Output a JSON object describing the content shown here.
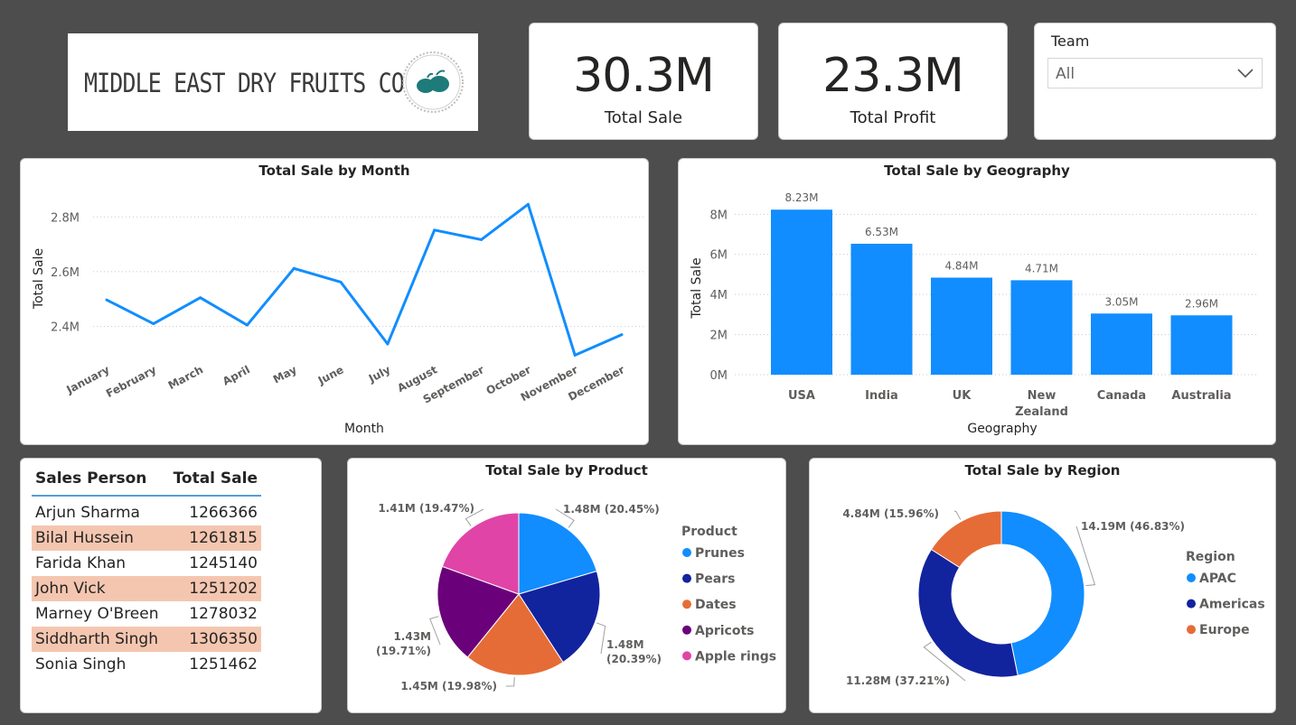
{
  "logo": {
    "text": "MIDDLE EAST DRY FRUITS CO."
  },
  "kpis": [
    {
      "value": "30.3M",
      "label": "Total Sale"
    },
    {
      "value": "23.3M",
      "label": "Total Profit"
    }
  ],
  "slicer": {
    "title": "Team",
    "value": "All"
  },
  "colors": {
    "line": "#118dff",
    "bar": "#118dff",
    "highlight_row": "#f4c6b0",
    "table_rule": "#5b9bd5"
  },
  "table": {
    "headers": [
      "Sales Person",
      "Total Sale"
    ],
    "rows": [
      {
        "name": "Arjun Sharma",
        "value": "1266366",
        "highlight": false
      },
      {
        "name": "Bilal Hussein",
        "value": "1261815",
        "highlight": true
      },
      {
        "name": "Farida Khan",
        "value": "1245140",
        "highlight": false
      },
      {
        "name": "John Vick",
        "value": "1251202",
        "highlight": true
      },
      {
        "name": "Marney O'Breen",
        "value": "1278032",
        "highlight": false
      },
      {
        "name": "Siddharth Singh",
        "value": "1306350",
        "highlight": true
      },
      {
        "name": "Sonia Singh",
        "value": "1251462",
        "highlight": false
      }
    ]
  },
  "chart_data": [
    {
      "type": "line",
      "title": "Total Sale by Month",
      "xlabel": "Month",
      "ylabel": "Total Sale",
      "categories": [
        "January",
        "February",
        "March",
        "April",
        "May",
        "June",
        "July",
        "August",
        "September",
        "October",
        "November",
        "December"
      ],
      "values": [
        2.497,
        2.41,
        2.505,
        2.405,
        2.612,
        2.562,
        2.336,
        2.752,
        2.717,
        2.846,
        2.295,
        2.37
      ],
      "yticks": [
        2.4,
        2.6,
        2.8
      ],
      "ytick_labels": [
        "2.4M",
        "2.6M",
        "2.8M"
      ],
      "ylim": [
        2.27,
        2.88
      ],
      "grid": true,
      "color": "#118dff"
    },
    {
      "type": "bar",
      "title": "Total Sale by Geography",
      "xlabel": "Geography",
      "ylabel": "Total Sale",
      "categories": [
        "USA",
        "India",
        "UK",
        "New Zealand",
        "Canada",
        "Australia"
      ],
      "values": [
        8.23,
        6.53,
        4.84,
        4.71,
        3.05,
        2.96
      ],
      "data_labels": [
        "8.23M",
        "6.53M",
        "4.84M",
        "4.71M",
        "3.05M",
        "2.96M"
      ],
      "yticks": [
        0,
        2,
        4,
        6,
        8
      ],
      "ytick_labels": [
        "0M",
        "2M",
        "4M",
        "6M",
        "8M"
      ],
      "ylim": [
        0,
        8.6
      ],
      "grid": true,
      "color": "#118dff"
    },
    {
      "type": "pie",
      "title": "Total Sale by Product",
      "legend_title": "Product",
      "legend_position": "right",
      "slices": [
        {
          "name": "Prunes",
          "value": 1.48,
          "percent": 20.45,
          "label": "1.48M (20.45%)",
          "color": "#118dff"
        },
        {
          "name": "Pears",
          "value": 1.48,
          "percent": 20.39,
          "label": "1.48M (20.39%)",
          "color": "#12239e"
        },
        {
          "name": "Dates",
          "value": 1.45,
          "percent": 19.98,
          "label": "1.45M (19.98%)",
          "color": "#e66c37"
        },
        {
          "name": "Apricots",
          "value": 1.43,
          "percent": 19.71,
          "label": "1.43M (19.71%)",
          "color": "#6b007b"
        },
        {
          "name": "Apple rings",
          "value": 1.41,
          "percent": 19.47,
          "label": "1.41M (19.47%)",
          "color": "#e044a7"
        }
      ]
    },
    {
      "type": "pie",
      "donut": true,
      "title": "Total Sale by Region",
      "legend_title": "Region",
      "legend_position": "right",
      "slices": [
        {
          "name": "APAC",
          "value": 14.19,
          "percent": 46.83,
          "label": "14.19M (46.83%)",
          "color": "#118dff"
        },
        {
          "name": "Americas",
          "value": 11.28,
          "percent": 37.21,
          "label": "11.28M (37.21%)",
          "color": "#12239e"
        },
        {
          "name": "Europe",
          "value": 4.84,
          "percent": 15.96,
          "label": "4.84M (15.96%)",
          "color": "#e66c37"
        }
      ]
    }
  ]
}
